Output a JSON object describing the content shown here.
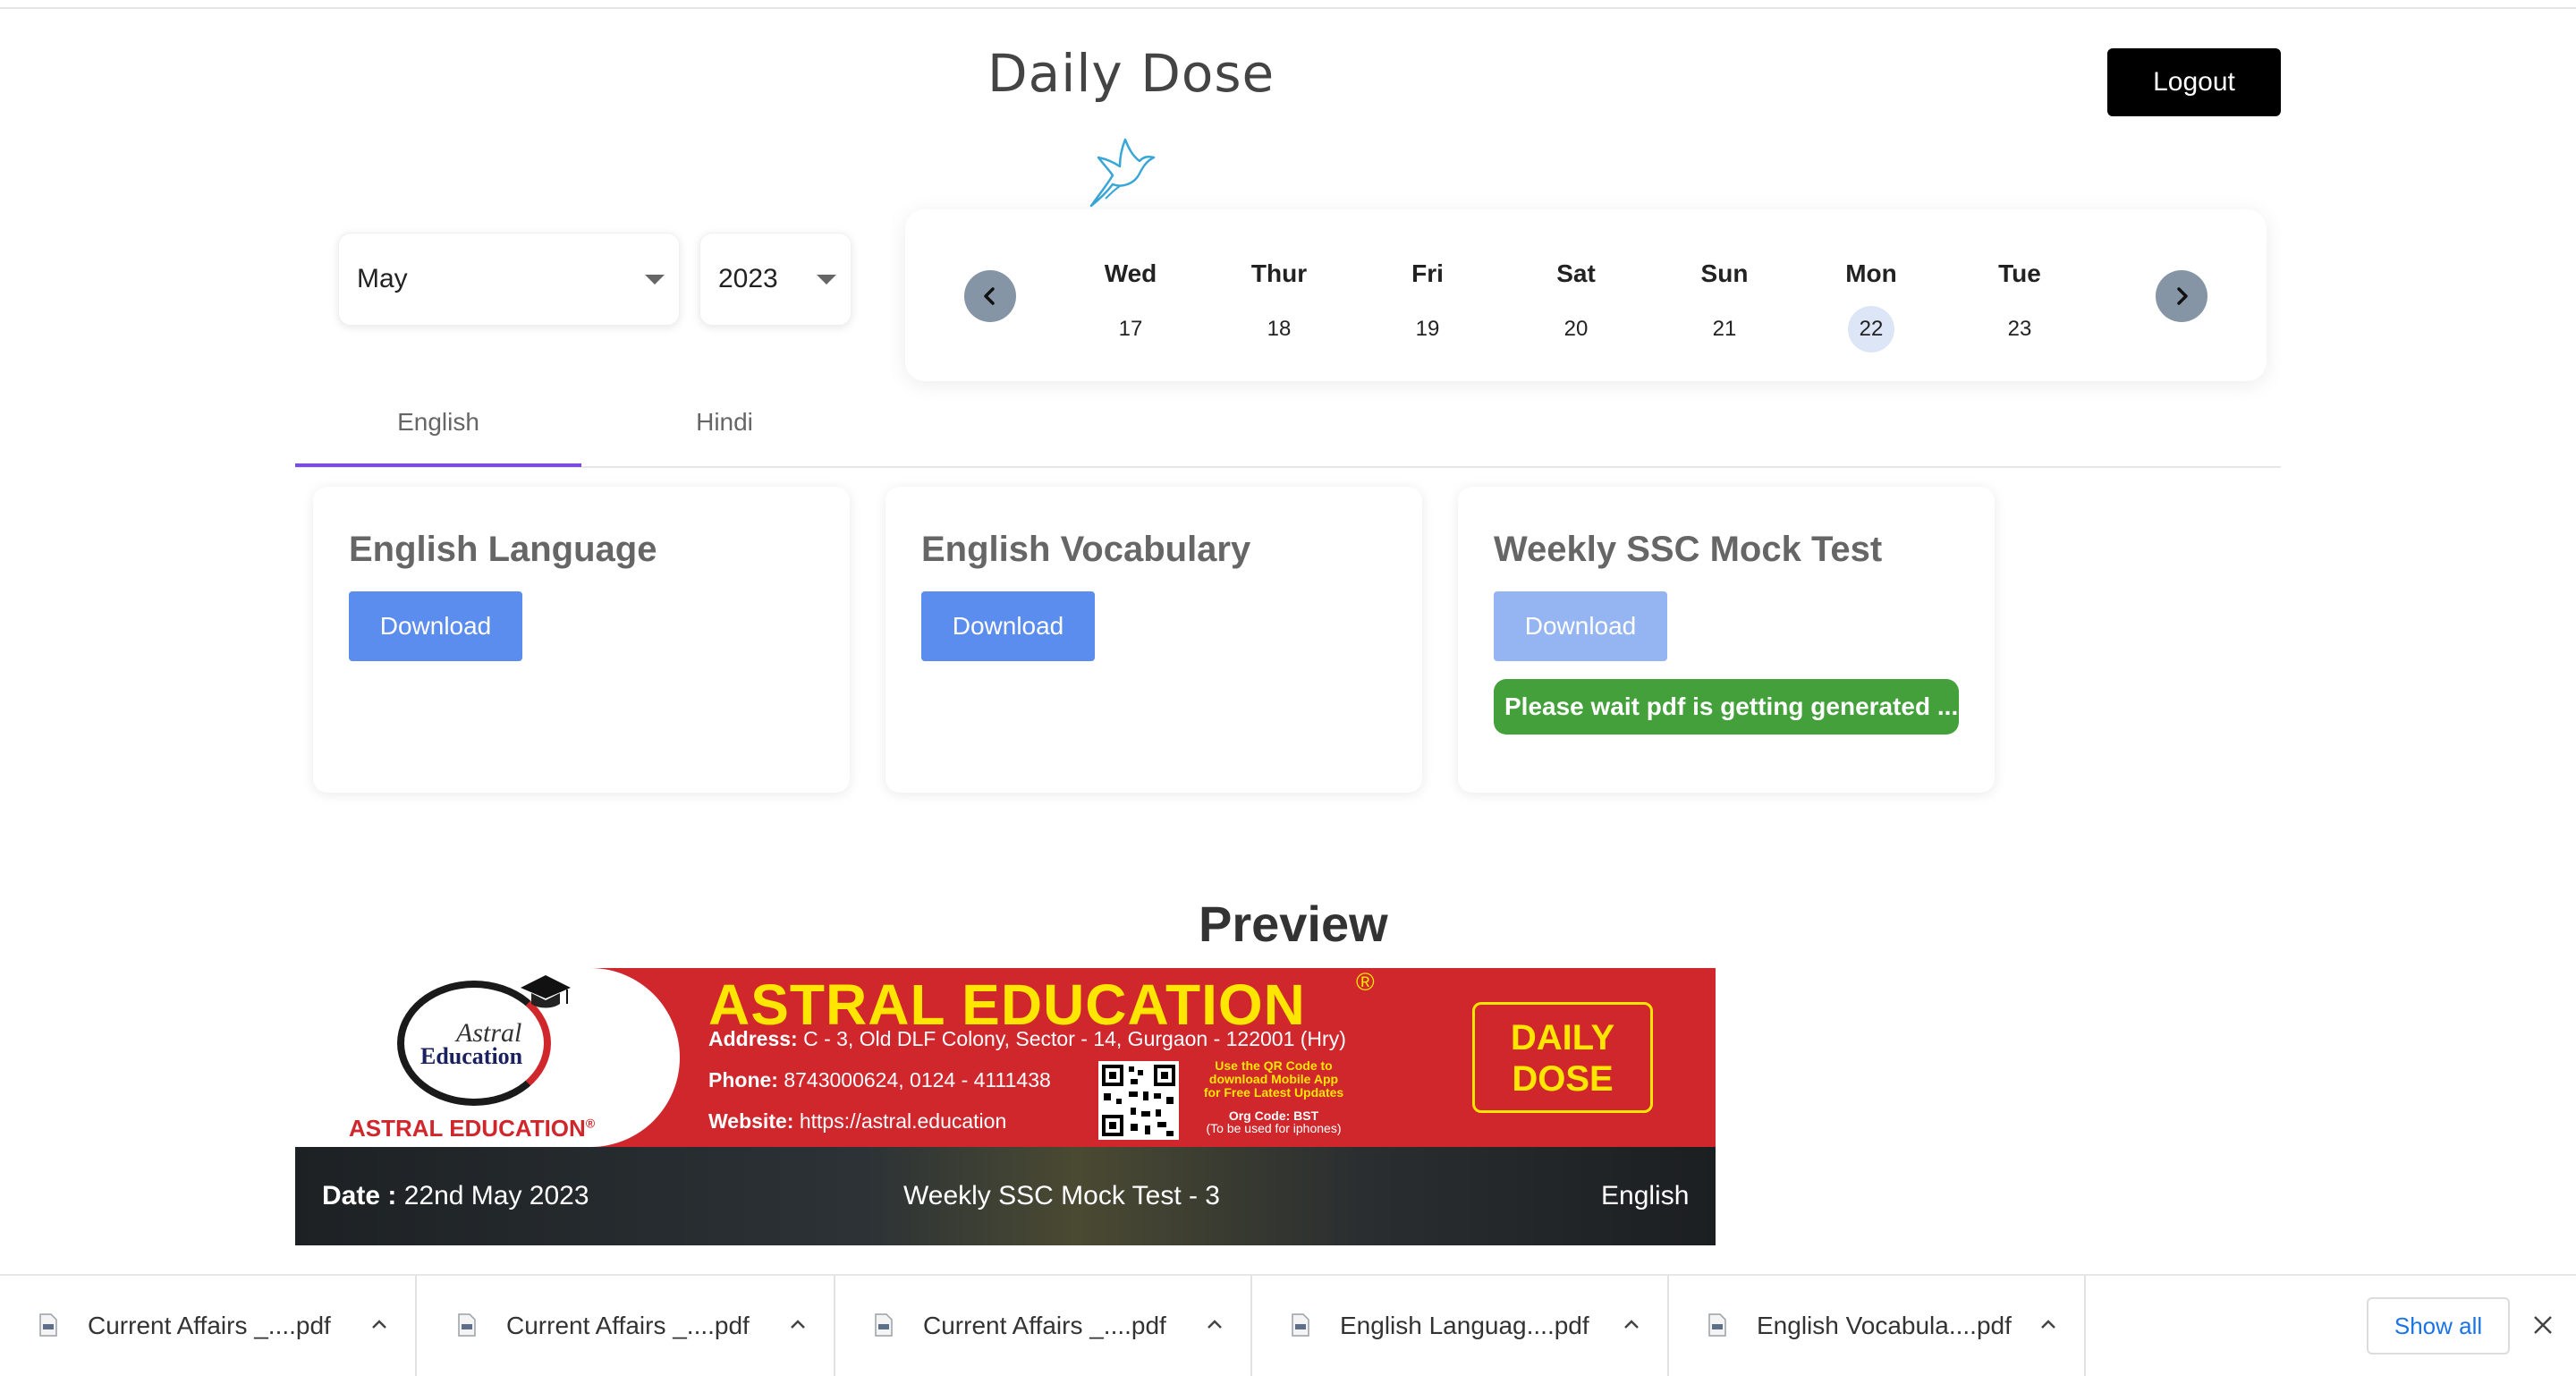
{
  "header": {
    "title": "Daily Dose",
    "logout_label": "Logout"
  },
  "filters": {
    "month": "May",
    "year": "2023"
  },
  "calendar": {
    "days": [
      {
        "name": "Wed",
        "date": "17"
      },
      {
        "name": "Thur",
        "date": "18"
      },
      {
        "name": "Fri",
        "date": "19"
      },
      {
        "name": "Sat",
        "date": "20"
      },
      {
        "name": "Sun",
        "date": "21"
      },
      {
        "name": "Mon",
        "date": "22",
        "selected": true
      },
      {
        "name": "Tue",
        "date": "23"
      }
    ]
  },
  "tabs": {
    "english": "English",
    "hindi": "Hindi",
    "active": "English"
  },
  "cards": [
    {
      "title": "English Language",
      "button": "Download"
    },
    {
      "title": "English Vocabulary",
      "button": "Download"
    },
    {
      "title": "Weekly SSC Mock Test",
      "button": "Download",
      "status": "Please wait pdf is getting generated ..."
    }
  ],
  "preview": {
    "heading": "Preview",
    "banner": {
      "logo_astral": "Astral",
      "logo_education": "Education",
      "logo_caption": "ASTRAL EDUCATION",
      "logo_caption_reg": "®",
      "brand": "ASTRAL EDUCATION",
      "brand_reg": "®",
      "address_label": "Address:",
      "address": "C - 3, Old DLF Colony, Sector - 14, Gurgaon - 122001 (Hry)",
      "phone_label": "Phone:",
      "phone": "8743000624, 0124 - 4111438",
      "website_label": "Website:",
      "website": "https://astral.education",
      "qr_note_1": "Use the QR Code to",
      "qr_note_2": "download Mobile App",
      "qr_note_3": "for Free Latest Updates",
      "org_code": "Org Code: BST",
      "org_note": "(To be used for iphones)",
      "dose_line_1": "DAILY",
      "dose_line_2": "DOSE",
      "date_label": "Date :",
      "date_value": "22nd May 2023",
      "test_name": "Weekly SSC Mock Test - 3",
      "language": "English"
    }
  },
  "downloads": {
    "items": [
      "Current Affairs _....pdf",
      "Current Affairs _....pdf",
      "Current Affairs _....pdf",
      "English Languag....pdf",
      "English Vocabula....pdf"
    ],
    "show_all": "Show all"
  },
  "colors": {
    "accent_tab": "#7b4ce0",
    "button_blue": "#5b8def",
    "status_green": "#43a03a",
    "banner_red": "#d0272d",
    "banner_yellow": "#ffe600"
  },
  "icons": {
    "bird": "bird-icon",
    "prev": "chevron-left-icon",
    "next": "chevron-right-icon",
    "file": "pdf-file-icon",
    "expand": "chevron-up-icon",
    "close": "close-icon"
  }
}
